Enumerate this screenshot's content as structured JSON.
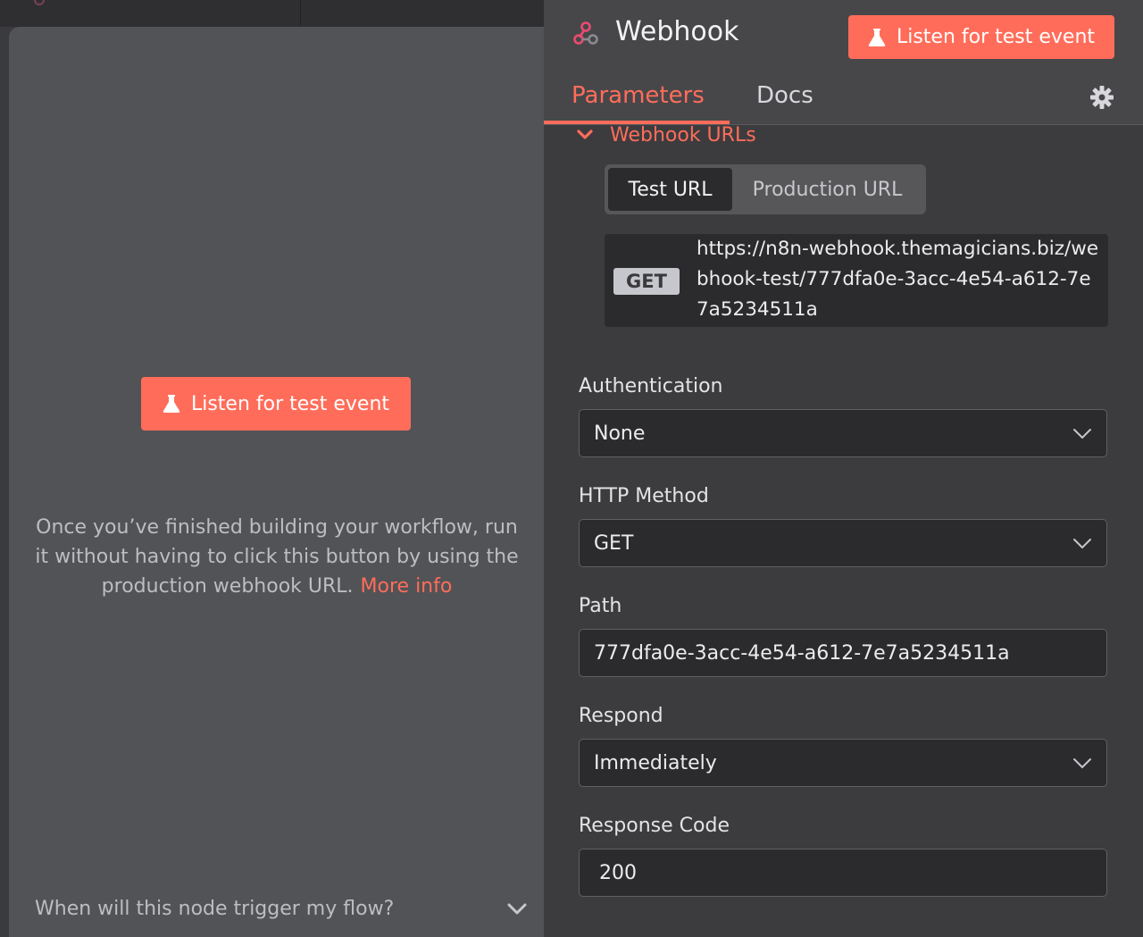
{
  "left": {
    "listen_button_label": "Listen for test event",
    "info_text": "Once you’ve finished building your workflow, run it without having to click this button by using the production webhook URL.",
    "more_info_link": "More info",
    "faq_question": "When will this node trigger my flow?"
  },
  "node": {
    "title": "Webhook",
    "listen_button_label": "Listen for test event"
  },
  "tabs": {
    "parameters": "Parameters",
    "docs": "Docs"
  },
  "webhook_urls": {
    "section_label": "Webhook URLs",
    "test_tab": "Test URL",
    "production_tab": "Production URL",
    "method": "GET",
    "url": "https://n8n-webhook.themagicians.biz/webhook-test/777dfa0e-3acc-4e54-a612-7e7a5234511a"
  },
  "fields": {
    "authentication": {
      "label": "Authentication",
      "value": "None"
    },
    "http_method": {
      "label": "HTTP Method",
      "value": "GET"
    },
    "path": {
      "label": "Path",
      "value": "777dfa0e-3acc-4e54-a612-7e7a5234511a"
    },
    "respond": {
      "label": "Respond",
      "value": "Immediately"
    },
    "response_code": {
      "label": "Response Code",
      "value": "200"
    }
  },
  "colors": {
    "accent": "#ff6d5a",
    "panel_bg": "#3c3c3f",
    "input_bg": "#2b2b2e"
  }
}
